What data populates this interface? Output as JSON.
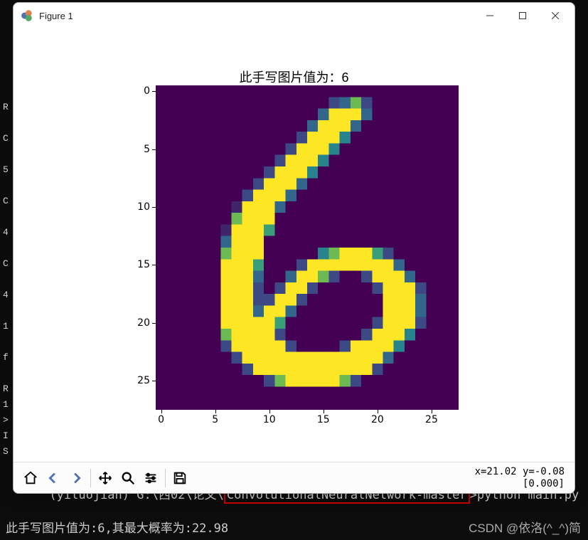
{
  "window": {
    "title": "Figure 1"
  },
  "chart_data": {
    "type": "heatmap",
    "title": "此手写图片值为：6",
    "xticks": [
      0,
      5,
      10,
      15,
      20,
      25
    ],
    "yticks": [
      0,
      5,
      10,
      15,
      20,
      25
    ],
    "xlim": [
      -0.5,
      27.5
    ],
    "ylim": [
      27.5,
      -0.5
    ],
    "colormap": "viridis",
    "rows": 28,
    "cols": 28,
    "pixels": [
      "0000000000000000000000000000",
      "0000000000000000236200000000",
      "0000000000000003999300000000",
      "0000000000000039993000000000",
      "0000000000000299940000000000",
      "0000000000002999400000000000",
      "0000000000029994000000000000",
      "0000000000299940000000000000",
      "0000000002999300000000000000",
      "0000000029993000000000000000",
      "0000000199930000000000000000",
      "0000000699900000000000000000",
      "0000001999500000000000000000",
      "0000003999000000000000000000",
      "0000006999000004699952000000",
      "0000009995000299999999300000",
      "0000009993003996200299930000",
      "0000009992029920000029992000",
      "0000009992299200000009993000",
      "0000009993993000000009993000",
      "0000009999950000000029992000",
      "0000006999920000000299940000",
      "0000002999992000029999400000",
      "0000000299999999999993000000",
      "0000000029999999999920000000",
      "0000000000269999962000000000",
      "0000000000000000000000000000",
      "0000000000000000000000000000"
    ]
  },
  "toolbar": {
    "coord_line1": "x=21.02 y=-0.08",
    "coord_line2": "[0.000]"
  },
  "terminal": {
    "prompt_prefix": "(yiluojian) G:\\西02\\论文\\",
    "prompt_highlight": "ConvolutionalNeuralNetwork-master",
    "prompt_suffix": ">python main.py",
    "line2": "此手写图片值为:6,其最大概率为:22.98",
    "watermark": "CSDN @依洛(^_^)简"
  }
}
